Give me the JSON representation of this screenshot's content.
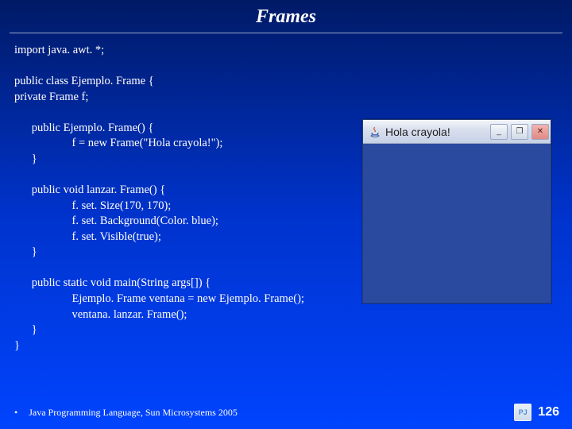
{
  "title": "Frames",
  "code": "import java. awt. *;\n\npublic class Ejemplo. Frame {\nprivate Frame f;\n\n      public Ejemplo. Frame() {\n                    f = new Frame(\"Hola crayola!\");\n      }\n\n      public void lanzar. Frame() {\n                    f. set. Size(170, 170);\n                    f. set. Background(Color. blue);\n                    f. set. Visible(true);\n      }\n\n      public static void main(String args[]) {\n                    Ejemplo. Frame ventana = new Ejemplo. Frame();\n                    ventana. lanzar. Frame();\n      }\n}",
  "awt_window": {
    "title": "Hola crayola!",
    "icon_label": "java-cup-icon",
    "buttons": {
      "min": "_",
      "max": "❐",
      "close": "✕"
    }
  },
  "footer": {
    "bullet": "•",
    "source": "Java Programming Language, Sun Microsystems 2005",
    "page": "126",
    "logo_text": "PJ"
  }
}
